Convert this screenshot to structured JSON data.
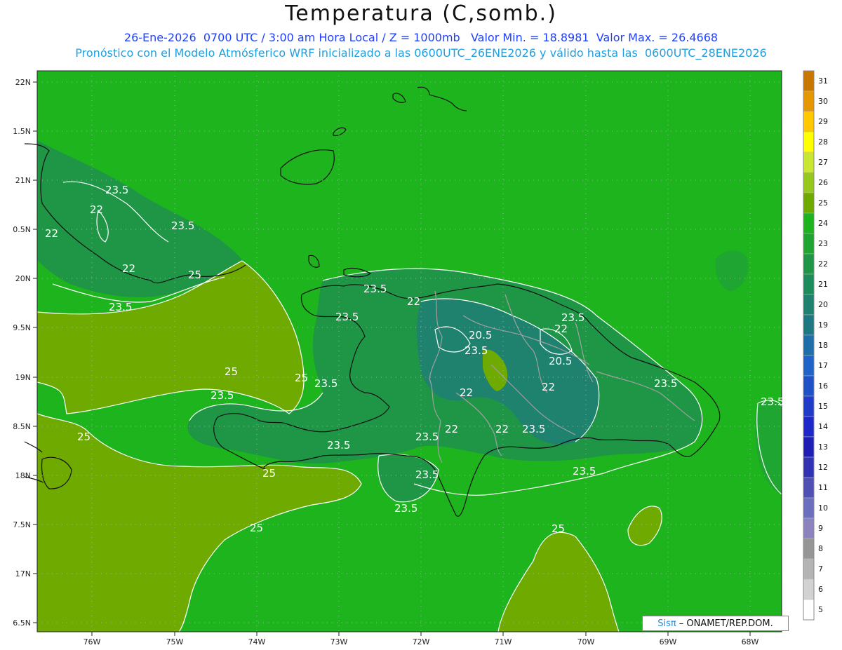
{
  "header": {
    "title": "Temperatura (C,somb.)",
    "line1": "26-Ene-2026  0700 UTC / 3:00 am Hora Local / Z = 1000mb   Valor Min. = 18.8981  Valor Max. = 26.4668",
    "line2": "Pronóstico con el Modelo Atmósferico WRF inicializado a las 0600UTC_26ENE2026 y válido hasta las  0600UTC_28ENE2026"
  },
  "axes": {
    "lat_labels": [
      "22N",
      "1.5N",
      "21N",
      "0.5N",
      "20N",
      "9.5N",
      "19N",
      "8.5N",
      "18N",
      "7.5N",
      "17N",
      "6.5N"
    ],
    "lon_labels": [
      "76W",
      "75W",
      "74W",
      "73W",
      "72W",
      "71W",
      "70W",
      "69W",
      "68W"
    ]
  },
  "contour_labels": [
    "23.5",
    "22",
    "23.5",
    "22",
    "22",
    "25",
    "23.5",
    "23.5",
    "22",
    "23.5",
    "20.5",
    "23.5",
    "22",
    "23.5",
    "20.5",
    "23.5",
    "22",
    "23.5",
    "25",
    "25",
    "23.5",
    "23.5",
    "22",
    "22",
    "22",
    "23.5",
    "23.5",
    "23.5",
    "25",
    "25",
    "23.5",
    "23.5",
    "23.5",
    "25",
    "25",
    "23.5",
    "22"
  ],
  "colorbar": {
    "ticks": [
      "31",
      "30",
      "29",
      "28",
      "27",
      "26",
      "25",
      "24",
      "23",
      "22",
      "21",
      "20",
      "19",
      "18",
      "17",
      "16",
      "15",
      "14",
      "13",
      "12",
      "11",
      "10",
      "9",
      "8",
      "7",
      "6",
      "5"
    ],
    "colors": [
      "#c87800",
      "#e69600",
      "#ffc800",
      "#ffff00",
      "#c8e632",
      "#96c81e",
      "#6eaa00",
      "#1eb41e",
      "#1ea532",
      "#1e9646",
      "#1e8c5a",
      "#1e826e",
      "#1e7882",
      "#1e6eaa",
      "#1e64c8",
      "#1e50c8",
      "#1e3cc8",
      "#1e28c8",
      "#1e1eb4",
      "#3232b4",
      "#5050b4",
      "#6e6ebe",
      "#8c82be",
      "#969696",
      "#b4b4b4",
      "#d2d2d2",
      "#ffffff"
    ]
  },
  "watermark": {
    "brand": "Sisπ",
    "text": "– ONAMET/REP.DOM."
  }
}
